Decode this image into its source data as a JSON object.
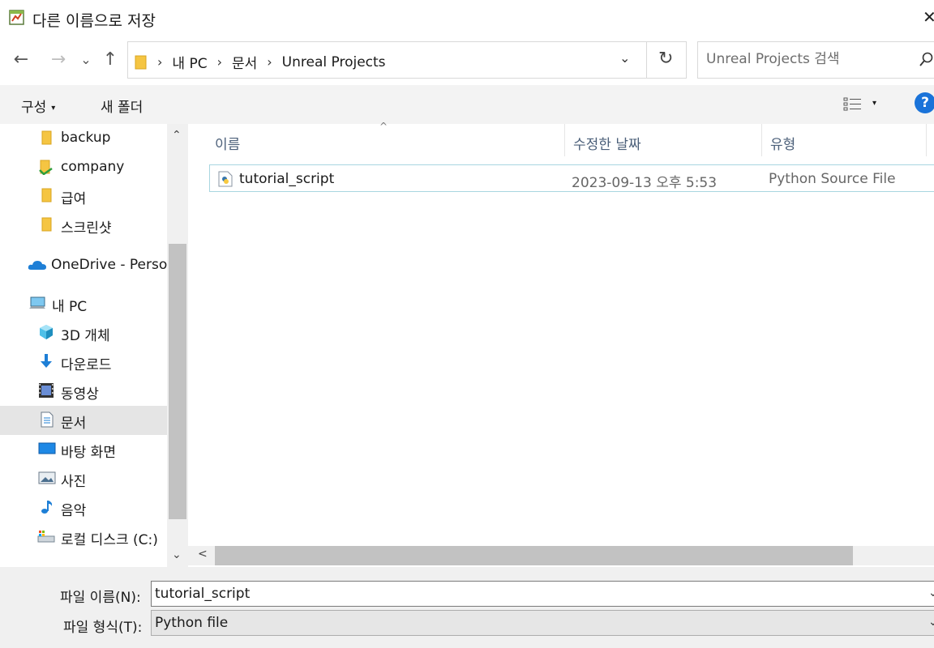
{
  "window": {
    "title": "다른 이름으로 저장",
    "close_label": "✕"
  },
  "nav_buttons": {
    "back": "←",
    "forward": "→",
    "recent": "⌄",
    "up": "↑"
  },
  "address": {
    "crumbs": [
      "내 PC",
      "문서",
      "Unreal Projects"
    ],
    "separator": "›",
    "dropdown": "⌄",
    "refresh": "↻"
  },
  "search": {
    "placeholder": "Unreal Projects 검색"
  },
  "command_bar": {
    "organize": "구성",
    "organize_caret": "▾",
    "new_folder": "새 폴더",
    "view_caret": "▾",
    "help": "?"
  },
  "nav_pane": {
    "items": [
      {
        "label": "backup",
        "icon": "folder-icon"
      },
      {
        "label": "company",
        "icon": "folder-icon"
      },
      {
        "label": "급여",
        "icon": "folder-icon"
      },
      {
        "label": "스크린샷",
        "icon": "folder-icon"
      },
      {
        "label": "OneDrive - Person",
        "icon": "cloud-icon"
      },
      {
        "label": "내 PC",
        "icon": "computer-icon"
      },
      {
        "label": "3D 개체",
        "icon": "cube-icon"
      },
      {
        "label": "다운로드",
        "icon": "download-icon"
      },
      {
        "label": "동영상",
        "icon": "video-icon"
      },
      {
        "label": "문서",
        "icon": "document-icon",
        "selected": true
      },
      {
        "label": "바탕 화면",
        "icon": "desktop-icon"
      },
      {
        "label": "사진",
        "icon": "picture-icon"
      },
      {
        "label": "음악",
        "icon": "music-icon"
      },
      {
        "label": "로컬 디스크 (C:)",
        "icon": "drive-icon"
      }
    ],
    "scroll_up": "⌃",
    "scroll_down": "⌄"
  },
  "file_list": {
    "columns": [
      "이름",
      "수정한 날짜",
      "유형"
    ],
    "sort_indicator": "^",
    "rows": [
      {
        "name": "tutorial_script",
        "modified": "2023-09-13 오후 5:53",
        "type": "Python Source File",
        "icon": "python-file-icon"
      }
    ],
    "scroll_left": "<"
  },
  "fields": {
    "filename_label": "파일 이름(N):",
    "filename_value": "tutorial_script",
    "filetype_label": "파일 형식(T):",
    "filetype_value": "Python file",
    "caret": "⌄"
  }
}
